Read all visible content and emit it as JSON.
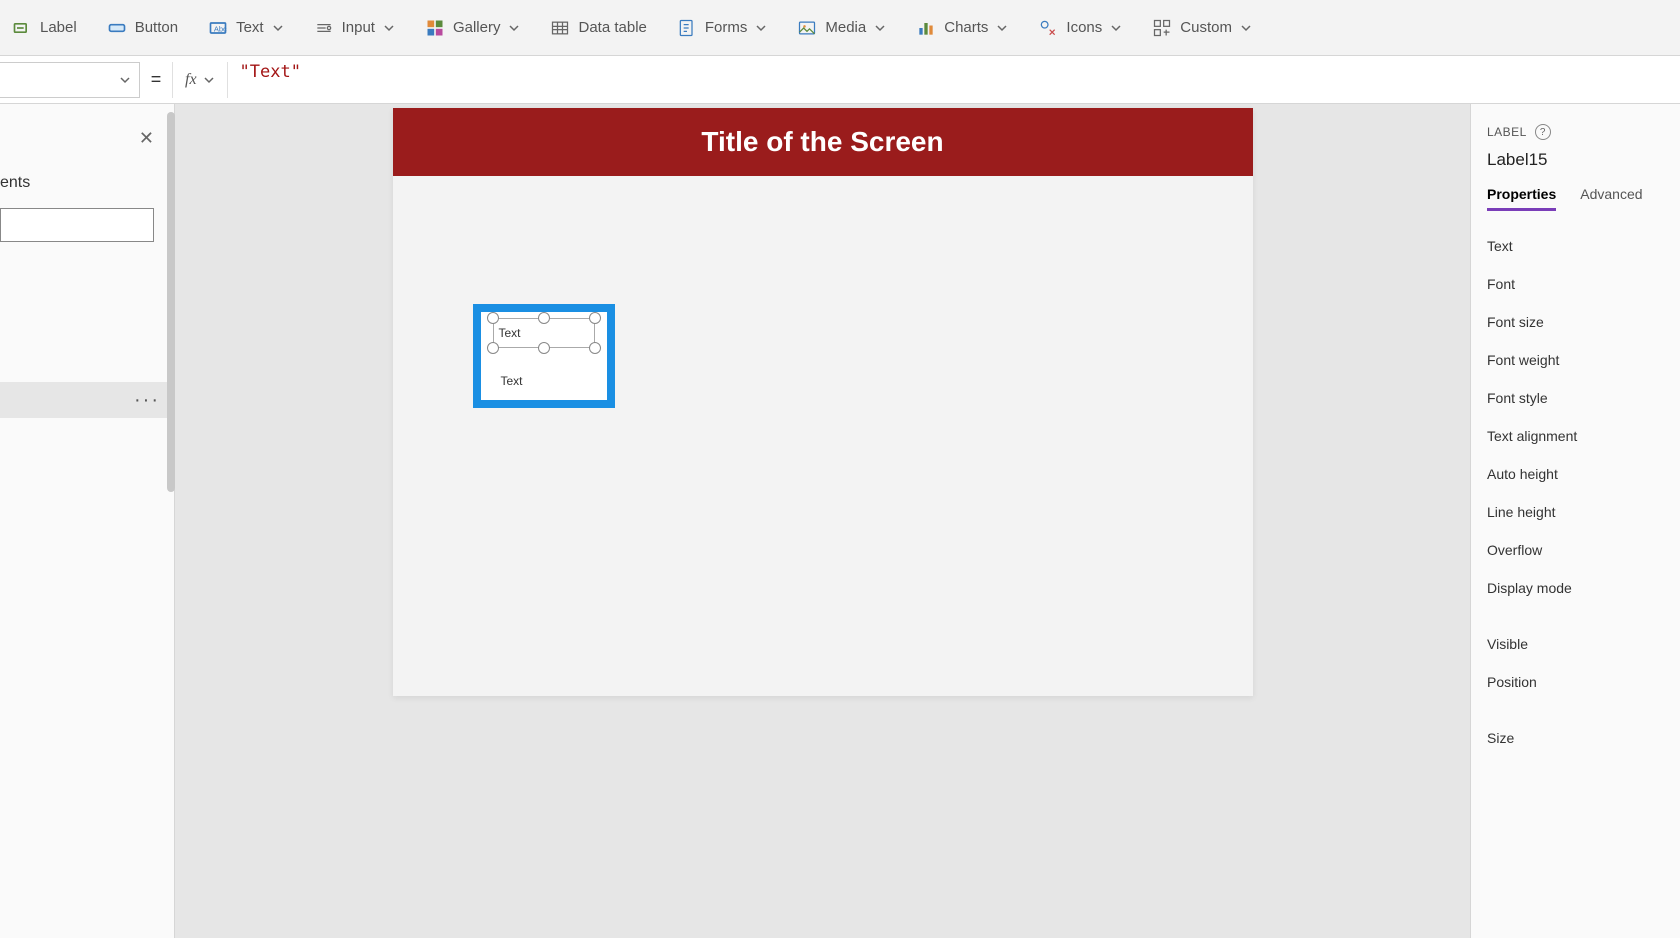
{
  "ribbon": {
    "items": [
      {
        "label": "Label",
        "has_chevron": false,
        "icon": "label"
      },
      {
        "label": "Button",
        "has_chevron": false,
        "icon": "button"
      },
      {
        "label": "Text",
        "has_chevron": true,
        "icon": "text"
      },
      {
        "label": "Input",
        "has_chevron": true,
        "icon": "input"
      },
      {
        "label": "Gallery",
        "has_chevron": true,
        "icon": "gallery"
      },
      {
        "label": "Data table",
        "has_chevron": false,
        "icon": "datatable"
      },
      {
        "label": "Forms",
        "has_chevron": true,
        "icon": "forms"
      },
      {
        "label": "Media",
        "has_chevron": true,
        "icon": "media"
      },
      {
        "label": "Charts",
        "has_chevron": true,
        "icon": "charts"
      },
      {
        "label": "Icons",
        "has_chevron": true,
        "icon": "icons"
      },
      {
        "label": "Custom",
        "has_chevron": true,
        "icon": "custom"
      }
    ]
  },
  "formula": {
    "equals": "=",
    "fx_label": "fx",
    "value": "\"Text\""
  },
  "left_panel": {
    "heading_suffix": "ents",
    "selected_row_more": "···"
  },
  "canvas": {
    "title": "Title of the Screen",
    "selected_label_text": "Text",
    "second_label_text": "Text"
  },
  "right_panel": {
    "type_label": "LABEL",
    "control_name": "Label15",
    "tabs": {
      "properties": "Properties",
      "advanced": "Advanced"
    },
    "rows": [
      "Text",
      "Font",
      "Font size",
      "Font weight",
      "Font style",
      "Text alignment",
      "Auto height",
      "Line height",
      "Overflow",
      "Display mode"
    ],
    "rows2": [
      "Visible",
      "Position",
      "Size"
    ]
  }
}
